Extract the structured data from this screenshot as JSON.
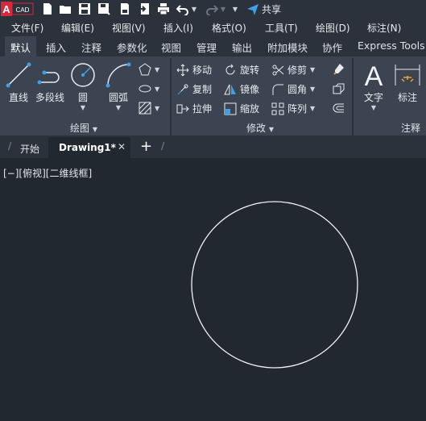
{
  "app": {
    "logo_text": "CAD",
    "logo_letter": "A"
  },
  "qat": {
    "share_label": "共享"
  },
  "menu": [
    "文件(F)",
    "编辑(E)",
    "视图(V)",
    "插入(I)",
    "格式(O)",
    "工具(T)",
    "绘图(D)",
    "标注(N)"
  ],
  "ribbon_tabs": [
    "默认",
    "插入",
    "注释",
    "参数化",
    "视图",
    "管理",
    "输出",
    "附加模块",
    "协作",
    "Express Tools"
  ],
  "active_ribbon_tab": "默认",
  "draw_panel": {
    "title": "绘图",
    "line": "直线",
    "polyline": "多段线",
    "circle": "圆",
    "arc": "圆弧"
  },
  "modify_panel": {
    "title": "修改",
    "move": "移动",
    "rotate": "旋转",
    "trim": "修剪",
    "copy": "复制",
    "mirror": "镜像",
    "fillet": "圆角",
    "stretch": "拉伸",
    "scale": "缩放",
    "array": "阵列"
  },
  "annotation_panel": {
    "title": "注释",
    "text": "文字",
    "dimension": "标注"
  },
  "file_tabs": {
    "start": "开始",
    "drawing": "Drawing1*"
  },
  "viewport": {
    "label": "[−][俯视][二维线框]"
  },
  "colors": {
    "background": "#212830",
    "ribbon": "#3b4450",
    "accent_red": "#d8283c",
    "share_blue": "#3ea0e8"
  }
}
